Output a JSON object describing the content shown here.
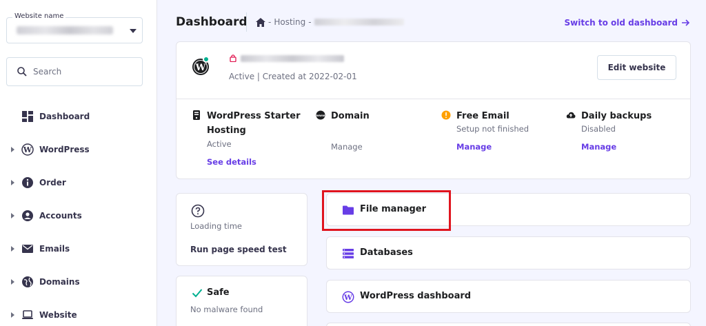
{
  "sidebar": {
    "website_select_label": "Website name",
    "search_placeholder": "Search",
    "items": [
      {
        "label": "Dashboard",
        "icon": "grid-icon"
      },
      {
        "label": "WordPress",
        "icon": "wordpress-icon"
      },
      {
        "label": "Order",
        "icon": "info-icon"
      },
      {
        "label": "Accounts",
        "icon": "account-icon"
      },
      {
        "label": "Emails",
        "icon": "mail-icon"
      },
      {
        "label": "Domains",
        "icon": "globe-icon"
      },
      {
        "label": "Website",
        "icon": "laptop-icon"
      }
    ]
  },
  "header": {
    "title": "Dashboard",
    "breadcrumb": [
      "Hosting"
    ],
    "switch_link": "Switch to old dashboard"
  },
  "site": {
    "status": "Active | Created at 2022-02-01",
    "edit_button": "Edit website"
  },
  "features": [
    {
      "title": "WordPress Starter Hosting",
      "subtitle": "Active",
      "link": "See details"
    },
    {
      "title": "Domain",
      "subtitle": "",
      "link": "Manage"
    },
    {
      "title": "Free Email",
      "subtitle": "Setup not finished",
      "link": "Manage"
    },
    {
      "title": "Daily backups",
      "subtitle": "Disabled",
      "link": "Manage"
    }
  ],
  "speed": {
    "label": "Loading time",
    "action": "Run page speed test"
  },
  "security": {
    "title": "Safe",
    "subtitle": "No malware found"
  },
  "tools": [
    {
      "label": "File manager",
      "icon": "folder-icon"
    },
    {
      "label": "Databases",
      "icon": "database-icon"
    },
    {
      "label": "WordPress dashboard",
      "icon": "wordpress-icon"
    }
  ],
  "colors": {
    "accent": "#673de6",
    "highlight": "#e0141e",
    "online": "#00b090",
    "warning": "#ffa000"
  }
}
